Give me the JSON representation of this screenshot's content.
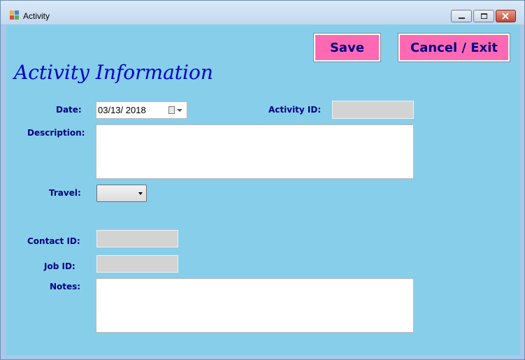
{
  "window": {
    "title": "Activity"
  },
  "toolbar": {
    "save_label": "Save",
    "cancel_label": "Cancel / Exit"
  },
  "form": {
    "heading": "Activity Information",
    "date_label": "Date:",
    "date_value": "03/13/ 2018",
    "activity_id_label": "Activity ID:",
    "activity_id_value": "",
    "description_label": "Description:",
    "description_value": "",
    "travel_label": "Travel:",
    "travel_value": "",
    "contact_id_label": "Contact ID:",
    "contact_id_value": "",
    "job_id_label": "Job ID:",
    "job_id_value": "",
    "notes_label": "Notes:",
    "notes_value": ""
  },
  "colors": {
    "client_bg": "#87ceeb",
    "button_bg": "#ff69b4",
    "label_text": "#000080",
    "heading_text": "#0000cd",
    "readonly_field": "#d3d3d3"
  },
  "icons": [
    "app-icon",
    "minimize-icon",
    "maximize-icon",
    "close-icon",
    "calendar-icon",
    "dropdown-arrow-icon"
  ]
}
